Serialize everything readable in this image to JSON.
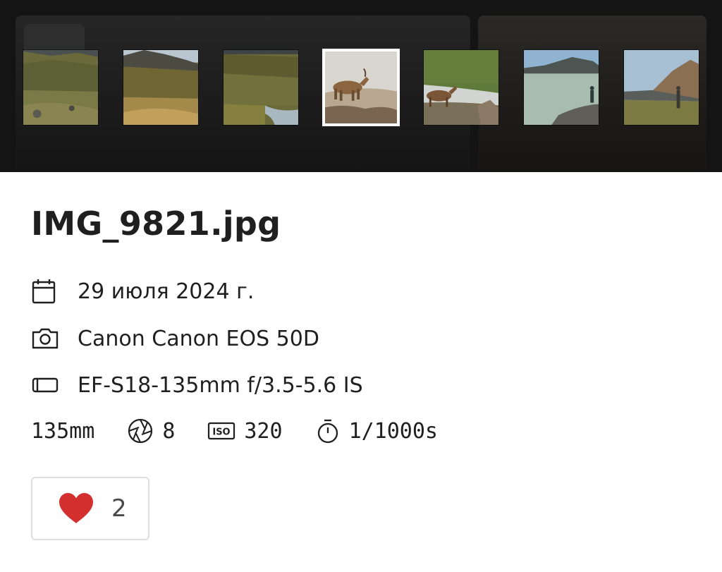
{
  "filmstrip": {
    "thumbnails": [
      {
        "name": "thumb-hillside-1",
        "scene": "grassy-slope"
      },
      {
        "name": "thumb-hillside-2",
        "scene": "grassy-slope"
      },
      {
        "name": "thumb-hillside-3",
        "scene": "slope-stream"
      },
      {
        "name": "thumb-ibex-snow",
        "scene": "ibex-snow",
        "selected": true
      },
      {
        "name": "thumb-ibex-stream",
        "scene": "ibex-stream"
      },
      {
        "name": "thumb-lake",
        "scene": "mountain-lake"
      },
      {
        "name": "thumb-person-valley",
        "scene": "person-valley"
      }
    ]
  },
  "photo": {
    "filename": "IMG_9821.jpg",
    "date": "29 июля 2024 г.",
    "camera": "Canon Canon EOS 50D",
    "lens": "EF-S18-135mm f/3.5-5.6 IS",
    "focal_length": "135mm",
    "aperture": "8",
    "iso": "320",
    "shutter": "1/1000s"
  },
  "likes": {
    "count": "2",
    "heart_color": "#d32f2f"
  },
  "icons": {
    "date": "calendar-icon",
    "camera": "camera-icon",
    "lens": "lens-icon",
    "aperture": "aperture-icon",
    "iso": "iso-icon",
    "shutter": "timer-icon",
    "like": "heart-icon"
  }
}
